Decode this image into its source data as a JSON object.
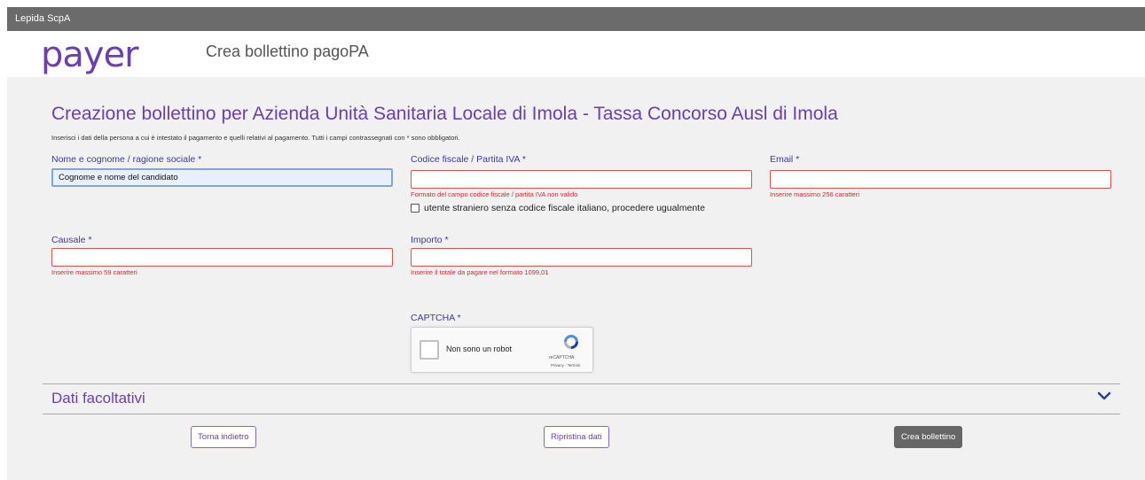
{
  "topbar": {
    "org": "Lepida ScpA"
  },
  "header": {
    "logo_text": "payer",
    "title": "Crea bollettino pagoPA"
  },
  "page": {
    "title": "Creazione bollettino per Azienda Unità Sanitaria Locale di Imola - Tassa Concorso Ausl di Imola",
    "instructions": "Inserisci i dati della persona a cui è intestato il pagamento e quelli relativi al pagamento. Tutti i campi contrassegnati con * sono obbligatori."
  },
  "form": {
    "name": {
      "label": "Nome e cognome / ragione sociale *",
      "value": "Cognome e nome del candidato"
    },
    "tax_code": {
      "label": "Codice fiscale / Partita IVA *",
      "value": "",
      "error": "Formato del campo codice fiscale / partita IVA non valido"
    },
    "foreign_user": {
      "label": "utente straniero senza codice fiscale italiano, procedere ugualmente",
      "checked": false
    },
    "email": {
      "label": "Email *",
      "value": "",
      "error": "Inserire massimo 256 caratteri"
    },
    "reason": {
      "label": "Causale *",
      "value": "",
      "error": "Inserire massimo 59 caratteri"
    },
    "amount": {
      "label": "Importo *",
      "value": "",
      "error": "Inserire il totale da pagare nel formato 1099,01"
    },
    "captcha": {
      "label": "CAPTCHA *",
      "checkbox_text": "Non sono un robot",
      "brand": "reCAPTCHA",
      "terms": "Privacy - Termini"
    }
  },
  "optional_section": {
    "title": "Dati facoltativi",
    "icon": "chevron-down-icon"
  },
  "buttons": {
    "back": "Torna indietro",
    "reset": "Ripristina dati",
    "create": "Crea bollettino"
  },
  "colors": {
    "accent": "#6a3fb0",
    "error": "#cc2b2b",
    "topbar": "#6b6b6b",
    "background": "#f1f1f1"
  }
}
